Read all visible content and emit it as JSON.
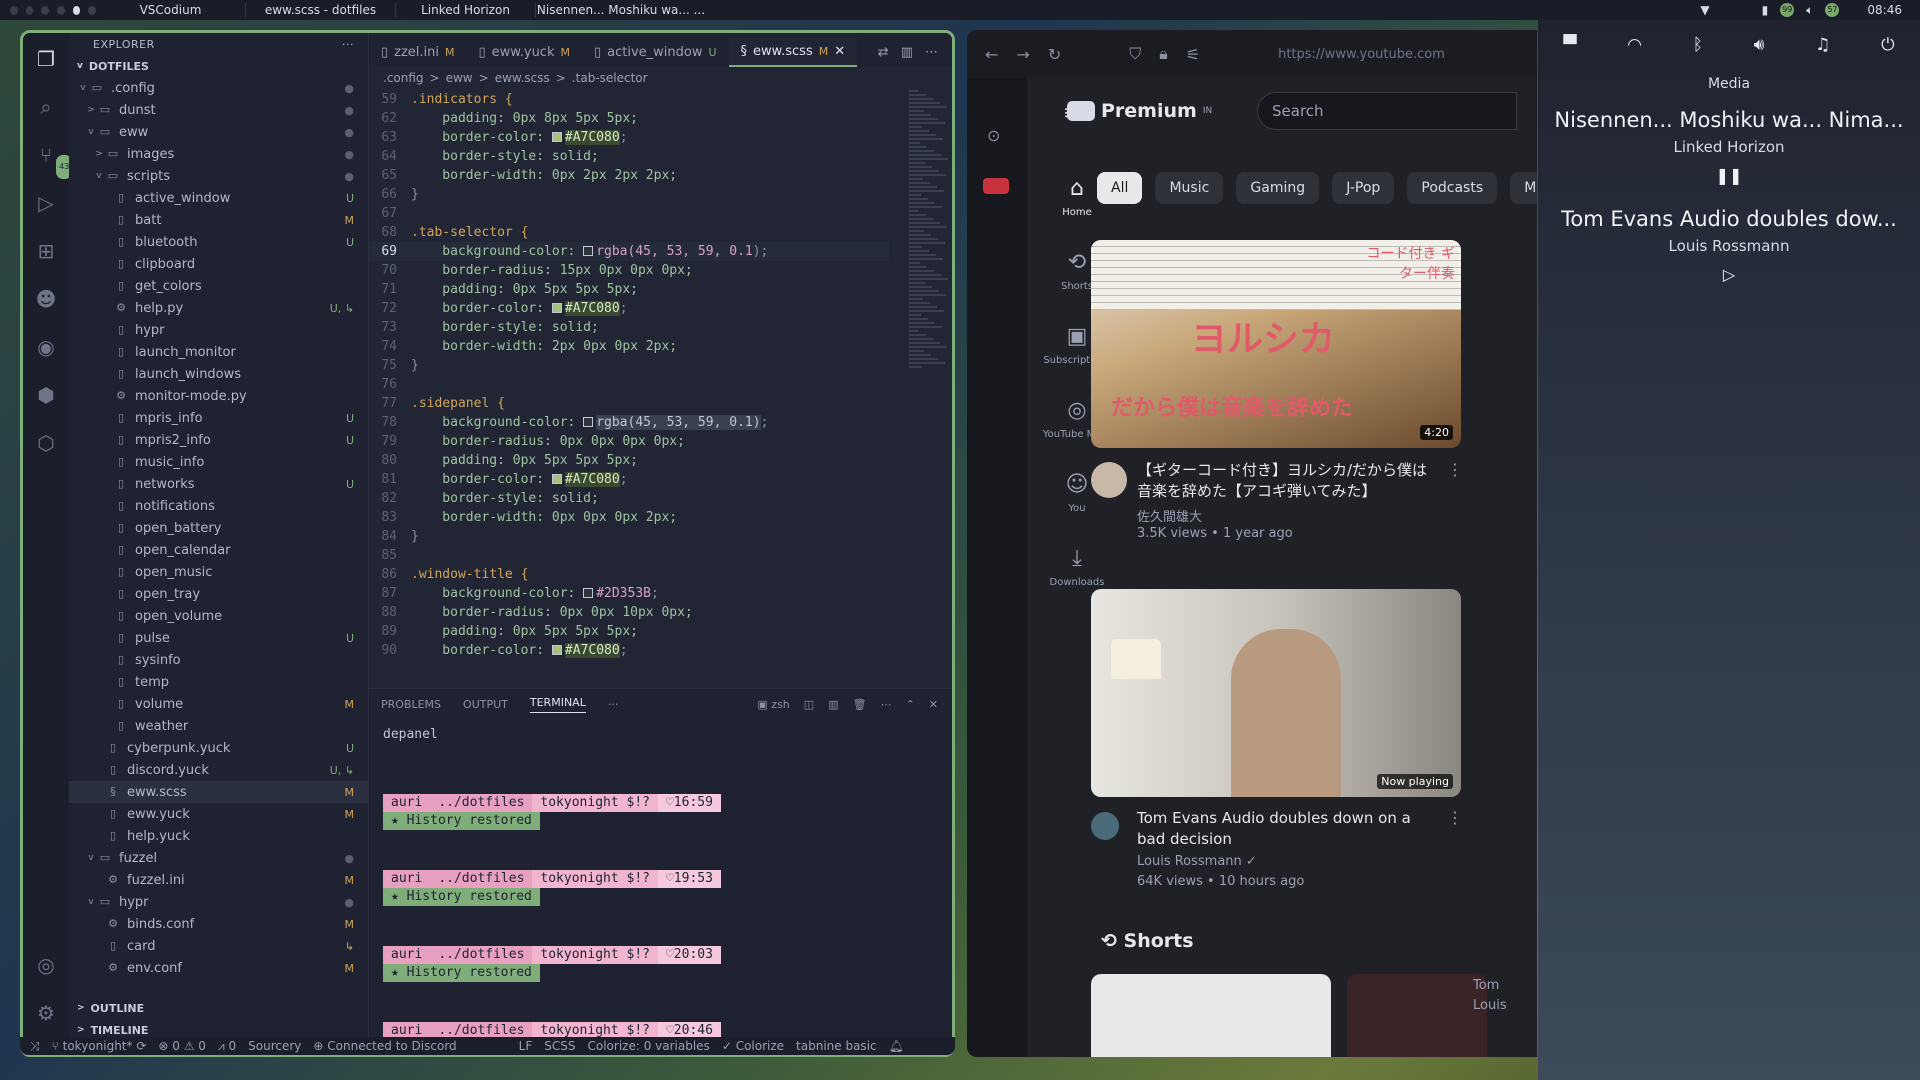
{
  "topbar": {
    "tasks": [
      "VSCodium",
      "eww.scss - dotfiles",
      "Linked Horizon",
      "Nisennen... Moshiku wa... ..."
    ],
    "badge1": "99",
    "badge2": "57",
    "time": "08:46"
  },
  "explorer": {
    "title": "EXPLORER",
    "more": "···",
    "root": "DOTFILES",
    "rows": [
      {
        "depth": 1,
        "chev": "v",
        "icon": "folder-config-icon",
        "label": ".config",
        "status": "●",
        "cls": "D"
      },
      {
        "depth": 2,
        "chev": ">",
        "icon": "folder-icon",
        "label": "dunst",
        "status": "●",
        "cls": "D"
      },
      {
        "depth": 2,
        "chev": "v",
        "icon": "folder-icon",
        "label": "eww",
        "status": "●",
        "cls": "D"
      },
      {
        "depth": 3,
        "chev": ">",
        "icon": "folder-images-icon",
        "label": "images",
        "status": "●",
        "cls": "D"
      },
      {
        "depth": 3,
        "chev": "v",
        "icon": "folder-scripts-icon",
        "label": "scripts",
        "status": "●",
        "cls": "D"
      },
      {
        "depth": 4,
        "chev": "",
        "icon": "file-icon",
        "label": "active_window",
        "status": "U",
        "cls": "U"
      },
      {
        "depth": 4,
        "chev": "",
        "icon": "file-icon",
        "label": "batt",
        "status": "M",
        "cls": "M"
      },
      {
        "depth": 4,
        "chev": "",
        "icon": "file-icon",
        "label": "bluetooth",
        "status": "U",
        "cls": "U"
      },
      {
        "depth": 4,
        "chev": "",
        "icon": "file-icon",
        "label": "clipboard",
        "status": "",
        "cls": ""
      },
      {
        "depth": 4,
        "chev": "",
        "icon": "file-icon",
        "label": "get_colors",
        "status": "",
        "cls": ""
      },
      {
        "depth": 4,
        "chev": "",
        "icon": "python-file-icon",
        "label": "help.py",
        "status": "U, ↳",
        "cls": "U"
      },
      {
        "depth": 4,
        "chev": "",
        "icon": "file-icon",
        "label": "hypr",
        "status": "",
        "cls": ""
      },
      {
        "depth": 4,
        "chev": "",
        "icon": "file-icon",
        "label": "launch_monitor",
        "status": "",
        "cls": ""
      },
      {
        "depth": 4,
        "chev": "",
        "icon": "file-icon",
        "label": "launch_windows",
        "status": "",
        "cls": ""
      },
      {
        "depth": 4,
        "chev": "",
        "icon": "python-file-icon",
        "label": "monitor-mode.py",
        "status": "",
        "cls": ""
      },
      {
        "depth": 4,
        "chev": "",
        "icon": "file-icon",
        "label": "mpris_info",
        "status": "U",
        "cls": "U"
      },
      {
        "depth": 4,
        "chev": "",
        "icon": "file-icon",
        "label": "mpris2_info",
        "status": "U",
        "cls": "U"
      },
      {
        "depth": 4,
        "chev": "",
        "icon": "file-icon",
        "label": "music_info",
        "status": "",
        "cls": ""
      },
      {
        "depth": 4,
        "chev": "",
        "icon": "file-icon",
        "label": "networks",
        "status": "U",
        "cls": "U"
      },
      {
        "depth": 4,
        "chev": "",
        "icon": "file-icon",
        "label": "notifications",
        "status": "",
        "cls": ""
      },
      {
        "depth": 4,
        "chev": "",
        "icon": "file-icon",
        "label": "open_battery",
        "status": "",
        "cls": ""
      },
      {
        "depth": 4,
        "chev": "",
        "icon": "file-icon",
        "label": "open_calendar",
        "status": "",
        "cls": ""
      },
      {
        "depth": 4,
        "chev": "",
        "icon": "file-icon",
        "label": "open_music",
        "status": "",
        "cls": ""
      },
      {
        "depth": 4,
        "chev": "",
        "icon": "file-icon",
        "label": "open_tray",
        "status": "",
        "cls": ""
      },
      {
        "depth": 4,
        "chev": "",
        "icon": "file-icon",
        "label": "open_volume",
        "status": "",
        "cls": ""
      },
      {
        "depth": 4,
        "chev": "",
        "icon": "file-icon",
        "label": "pulse",
        "status": "U",
        "cls": "U"
      },
      {
        "depth": 4,
        "chev": "",
        "icon": "file-icon",
        "label": "sysinfo",
        "status": "",
        "cls": ""
      },
      {
        "depth": 4,
        "chev": "",
        "icon": "file-icon",
        "label": "temp",
        "status": "",
        "cls": ""
      },
      {
        "depth": 4,
        "chev": "",
        "icon": "file-icon",
        "label": "volume",
        "status": "M",
        "cls": "M"
      },
      {
        "depth": 4,
        "chev": "",
        "icon": "file-icon",
        "label": "weather",
        "status": "",
        "cls": ""
      },
      {
        "depth": 3,
        "chev": "",
        "icon": "file-icon",
        "label": "cyberpunk.yuck",
        "status": "U",
        "cls": "U"
      },
      {
        "depth": 3,
        "chev": "",
        "icon": "file-icon",
        "label": "discord.yuck",
        "status": "U, ↳",
        "cls": "U"
      },
      {
        "depth": 3,
        "chev": "",
        "icon": "scss-file-icon",
        "label": "eww.scss",
        "status": "M",
        "cls": "M",
        "sel": true
      },
      {
        "depth": 3,
        "chev": "",
        "icon": "file-icon",
        "label": "eww.yuck",
        "status": "M",
        "cls": "M"
      },
      {
        "depth": 3,
        "chev": "",
        "icon": "file-icon",
        "label": "help.yuck",
        "status": "",
        "cls": ""
      },
      {
        "depth": 2,
        "chev": "v",
        "icon": "folder-icon",
        "label": "fuzzel",
        "status": "●",
        "cls": "D"
      },
      {
        "depth": 3,
        "chev": "",
        "icon": "gear-file-icon",
        "label": "fuzzel.ini",
        "status": "M",
        "cls": "M"
      },
      {
        "depth": 2,
        "chev": "v",
        "icon": "folder-icon",
        "label": "hypr",
        "status": "●",
        "cls": "D"
      },
      {
        "depth": 3,
        "chev": "",
        "icon": "gear-file-icon",
        "label": "binds.conf",
        "status": "M",
        "cls": "M"
      },
      {
        "depth": 3,
        "chev": "",
        "icon": "file-icon",
        "label": "card",
        "status": "↳",
        "cls": "M"
      },
      {
        "depth": 3,
        "chev": "",
        "icon": "gear-file-icon",
        "label": "env.conf",
        "status": "M",
        "cls": "M"
      }
    ],
    "outline": "OUTLINE",
    "timeline": "TIMELINE"
  },
  "editor": {
    "tabs": [
      {
        "label": "zzel.ini",
        "flag": "M",
        "active": false
      },
      {
        "label": "eww.yuck",
        "flag": "M",
        "active": false
      },
      {
        "label": "active_window",
        "flag": "U",
        "active": false
      },
      {
        "label": "eww.scss",
        "flag": "M",
        "active": true
      }
    ],
    "breadcrumb": [
      ".config",
      ">",
      "eww",
      ">",
      "eww.scss",
      ">",
      ".tab-selector"
    ],
    "lines": [
      {
        "n": "59",
        "segs": [
          {
            "t": ".indicators {",
            "c": "sel-kw"
          }
        ]
      },
      {
        "n": "62",
        "segs": [
          {
            "t": "    padding: 0px 8px 5px 5px;",
            "c": "prop"
          }
        ]
      },
      {
        "n": "63",
        "segs": [
          {
            "t": "    border-color: ",
            "c": "prop"
          },
          {
            "t": "#A7C080",
            "c": "hl",
            "sw": "#A7C080"
          },
          {
            "t": ";",
            "c": "pun"
          }
        ]
      },
      {
        "n": "64",
        "segs": [
          {
            "t": "    border-style: solid;",
            "c": "prop"
          }
        ]
      },
      {
        "n": "65",
        "segs": [
          {
            "t": "    border-width: 0px 2px 2px 2px;",
            "c": "prop"
          }
        ]
      },
      {
        "n": "66",
        "segs": [
          {
            "t": "}",
            "c": "pun"
          }
        ]
      },
      {
        "n": "67",
        "segs": [
          {
            "t": "",
            "c": ""
          }
        ]
      },
      {
        "n": "68",
        "segs": [
          {
            "t": ".tab-selector {",
            "c": "sel-kw"
          }
        ]
      },
      {
        "n": "69",
        "cur": true,
        "segs": [
          {
            "t": "    background-color: ",
            "c": "prop"
          },
          {
            "t": "rgba(45, 53, 59, 0.1",
            "c": "num",
            "sw": "#2D353B"
          },
          {
            "t": ");",
            "c": "pun"
          }
        ]
      },
      {
        "n": "70",
        "segs": [
          {
            "t": "    border-radius: 15px 0px 0px 0px;",
            "c": "prop"
          }
        ]
      },
      {
        "n": "71",
        "segs": [
          {
            "t": "    padding: 0px 5px 5px 5px;",
            "c": "prop"
          }
        ]
      },
      {
        "n": "72",
        "segs": [
          {
            "t": "    border-color: ",
            "c": "prop"
          },
          {
            "t": "#A7C080",
            "c": "hl",
            "sw": "#A7C080"
          },
          {
            "t": ";",
            "c": "pun"
          }
        ]
      },
      {
        "n": "73",
        "segs": [
          {
            "t": "    border-style: solid;",
            "c": "prop"
          }
        ]
      },
      {
        "n": "74",
        "segs": [
          {
            "t": "    border-width: 2px 0px 0px 2px;",
            "c": "prop"
          }
        ]
      },
      {
        "n": "75",
        "segs": [
          {
            "t": "}",
            "c": "pun"
          }
        ]
      },
      {
        "n": "76",
        "segs": [
          {
            "t": "",
            "c": ""
          }
        ]
      },
      {
        "n": "77",
        "segs": [
          {
            "t": ".sidepanel {",
            "c": "sel-kw"
          }
        ]
      },
      {
        "n": "78",
        "segs": [
          {
            "t": "    background-color: ",
            "c": "prop"
          },
          {
            "t": "rgba(45, 53, 59, 0.1)",
            "c": "hlg",
            "sw": "#2D353B"
          },
          {
            "t": ";",
            "c": "pun"
          }
        ]
      },
      {
        "n": "79",
        "segs": [
          {
            "t": "    border-radius: 0px 0px 0px 0px;",
            "c": "prop"
          }
        ]
      },
      {
        "n": "80",
        "segs": [
          {
            "t": "    padding: 0px 5px 5px 5px;",
            "c": "prop"
          }
        ]
      },
      {
        "n": "81",
        "segs": [
          {
            "t": "    border-color: ",
            "c": "prop"
          },
          {
            "t": "#A7C080",
            "c": "hl",
            "sw": "#A7C080"
          },
          {
            "t": ";",
            "c": "pun"
          }
        ]
      },
      {
        "n": "82",
        "segs": [
          {
            "t": "    border-style: solid;",
            "c": "prop"
          }
        ]
      },
      {
        "n": "83",
        "segs": [
          {
            "t": "    border-width: 0px 0px 0px 2px;",
            "c": "prop"
          }
        ]
      },
      {
        "n": "84",
        "segs": [
          {
            "t": "}",
            "c": "pun"
          }
        ]
      },
      {
        "n": "85",
        "segs": [
          {
            "t": "",
            "c": ""
          }
        ]
      },
      {
        "n": "86",
        "segs": [
          {
            "t": ".window-title {",
            "c": "sel-kw"
          }
        ]
      },
      {
        "n": "87",
        "segs": [
          {
            "t": "    background-color: ",
            "c": "prop"
          },
          {
            "t": "#2D353B",
            "c": "num",
            "sw": "#2D353B"
          },
          {
            "t": ";",
            "c": "pun"
          }
        ]
      },
      {
        "n": "88",
        "segs": [
          {
            "t": "    border-radius: 0px 0px 10px 0px;",
            "c": "prop"
          }
        ]
      },
      {
        "n": "89",
        "segs": [
          {
            "t": "    padding: 0px 5px 5px 5px;",
            "c": "prop"
          }
        ]
      },
      {
        "n": "90",
        "segs": [
          {
            "t": "    border-color: ",
            "c": "prop"
          },
          {
            "t": "#A7C080",
            "c": "hl",
            "sw": "#A7C080"
          },
          {
            "t": ";",
            "c": "pun"
          }
        ]
      }
    ]
  },
  "panel": {
    "tabs": [
      "PROBLEMS",
      "OUTPUT",
      "TERMINAL",
      "···"
    ],
    "shell": "zsh",
    "first_line": "depanel",
    "prompts": [
      {
        "user": "auri",
        "path": "../dotfiles",
        "branch": "tokyonight $!?",
        "time": "♡16:59",
        "hist": "★ History restored"
      },
      {
        "user": "auri",
        "path": "../dotfiles",
        "branch": "tokyonight $!?",
        "time": "♡19:53",
        "hist": "★ History restored"
      },
      {
        "user": "auri",
        "path": "../dotfiles",
        "branch": "tokyonight $!?",
        "time": "♡20:03",
        "hist": "★ History restored"
      },
      {
        "user": "auri",
        "path": "../dotfiles",
        "branch": "tokyonight $!?",
        "time": "♡20:46",
        "hist": ""
      }
    ]
  },
  "statusbar": {
    "branch": "tokyonight*",
    "problems": "⊗ 0 ⚠ 0",
    "ports": "⩘ 0",
    "sourcery": "Sourcery",
    "discord": "Connected to Discord",
    "eol": "LF",
    "lang": "SCSS",
    "colorize": "Colorize: 0 variables",
    "colorize2": "✓ Colorize",
    "tabnine": "tabnine basic"
  },
  "browser": {
    "url": "https://www.youtube.com",
    "logo": "Premium",
    "logo_sup": "IN",
    "search_placeholder": "Search",
    "nav": [
      "Home",
      "Shorts",
      "Subscriptions",
      "YouTube Mu...",
      "You",
      "Downloads"
    ],
    "chips": [
      "All",
      "Music",
      "Gaming",
      "J-Pop",
      "Podcasts",
      "Mix"
    ],
    "videos": [
      {
        "title": "【ギターコード付き】ヨルシカ/だから僕は音楽を辞めた【アコギ弾いてみた】",
        "channel": "佐久間雄大",
        "meta": "3.5K views • 1 year ago",
        "duration": "4:20",
        "thumb_text": "ヨルシカ",
        "thumb_sub": "だから僕は音楽を辞めた",
        "thumb_tag": "コード付き ギター伴奏"
      },
      {
        "title": "Tom Evans Audio doubles down on a bad decision",
        "channel": "Louis Rossmann",
        "meta": "64K views • 10 hours ago",
        "duration": "Now playing"
      }
    ],
    "shorts": "Shorts",
    "partial": [
      "Tom",
      "Louis"
    ]
  },
  "media": {
    "header": "Media",
    "items": [
      {
        "title": "Nisennen... Moshiku wa... Nima...",
        "artist": "Linked Horizon",
        "ctrl": "❚❚"
      },
      {
        "title": "Tom Evans Audio doubles dow...",
        "artist": "Louis Rossmann",
        "ctrl": "▷"
      }
    ]
  }
}
